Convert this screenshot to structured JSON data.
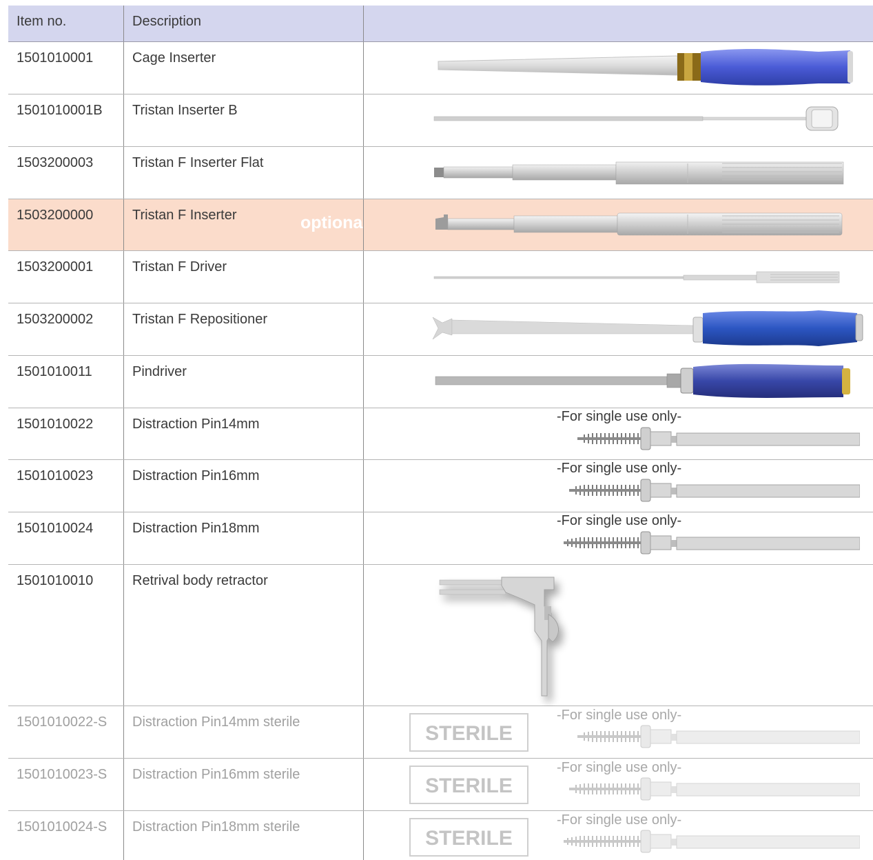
{
  "table": {
    "headers": {
      "item_no": "Item no.",
      "description": "Description",
      "image": ""
    },
    "rows": [
      {
        "item_no": "1501010001",
        "description": "Cage Inserter"
      },
      {
        "item_no": "1501010001B",
        "description": "Tristan Inserter B"
      },
      {
        "item_no": "1503200003",
        "description": "Tristan F Inserter Flat"
      },
      {
        "item_no": "1503200000",
        "description": "Tristan F Inserter",
        "label": "optional"
      },
      {
        "item_no": "1503200001",
        "description": "Tristan F Driver"
      },
      {
        "item_no": "1503200002",
        "description": "Tristan F Repositioner"
      },
      {
        "item_no": "1501010011",
        "description": "Pindriver"
      },
      {
        "item_no": "1501010022",
        "description": "Distraction Pin14mm",
        "note": "-For single use only-"
      },
      {
        "item_no": "1501010023",
        "description": "Distraction Pin16mm",
        "note": "-For single use only-"
      },
      {
        "item_no": "1501010024",
        "description": "Distraction Pin18mm",
        "note": "-For single use only-"
      },
      {
        "item_no": "1501010010",
        "description": "Retrival body retractor"
      },
      {
        "item_no": "1501010022-S",
        "description": "Distraction Pin14mm sterile",
        "badge": "STERILE",
        "note": "-For single use only-"
      },
      {
        "item_no": "1501010023-S",
        "description": "Distraction Pin16mm sterile",
        "badge": "STERILE",
        "note": "-For single use only-"
      },
      {
        "item_no": "1501010024-S",
        "description": "Distraction Pin18mm sterile",
        "badge": "STERILE",
        "note": "-For single use only-"
      }
    ]
  },
  "colors": {
    "header_bg": "#d4d6ee",
    "optional_row_bg": "#fbdccb",
    "handle_blue": "#4a5bd6",
    "handle_navy": "#3847a8",
    "sterile_text": "#a0a0a0"
  }
}
